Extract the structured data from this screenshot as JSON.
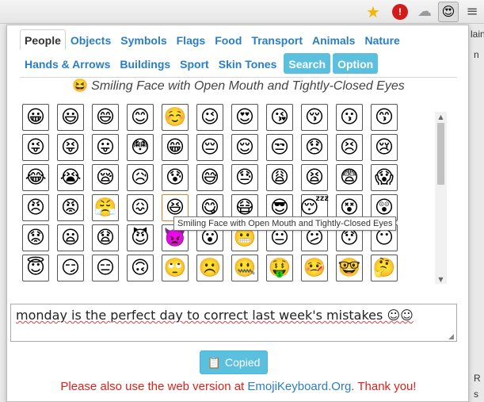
{
  "toolbar": {
    "icons": [
      "star-icon",
      "adblock-shield-icon",
      "cloud-icon",
      "emoji-keyboard-icon",
      "menu-icon"
    ],
    "star": "★",
    "shield": "!",
    "cloud": "☁",
    "emoji": "😍",
    "menu": "≡"
  },
  "background": {
    "side_text_1": "lain",
    "side_text_2": "n",
    "side_text_3": "R",
    "side_text_4": "s"
  },
  "tabs": [
    {
      "label": "People",
      "state": "active"
    },
    {
      "label": "Objects",
      "state": "normal"
    },
    {
      "label": "Symbols",
      "state": "normal"
    },
    {
      "label": "Flags",
      "state": "normal"
    },
    {
      "label": "Food",
      "state": "normal"
    },
    {
      "label": "Transport",
      "state": "normal"
    },
    {
      "label": "Animals",
      "state": "normal"
    },
    {
      "label": "Nature",
      "state": "normal"
    },
    {
      "label": "Hands & Arrows",
      "state": "normal"
    },
    {
      "label": "Buildings",
      "state": "normal"
    },
    {
      "label": "Sport",
      "state": "normal"
    },
    {
      "label": "Skin Tones",
      "state": "normal"
    },
    {
      "label": "Search",
      "state": "button"
    },
    {
      "label": "Option",
      "state": "button"
    }
  ],
  "selected": {
    "icon": "😆",
    "title": "Smiling Face with Open Mouth and Tightly-Closed Eyes"
  },
  "emoji_grid": [
    [
      "😀",
      "😃",
      "😄",
      "😊",
      "☺️",
      "😉",
      "😍",
      "😘",
      "😚",
      "😗",
      "😙"
    ],
    [
      "😜",
      "😝",
      "😛",
      "😳",
      "😁",
      "😔",
      "😌",
      "😒",
      "😞",
      "😣",
      "😢"
    ],
    [
      "😂",
      "😭",
      "😪",
      "😥",
      "😰",
      "😅",
      "😓",
      "😩",
      "😫",
      "😨",
      "😱"
    ],
    [
      "😠",
      "😡",
      "😤",
      "😖",
      "😆",
      "😋",
      "😷",
      "😎",
      "😴",
      "😵",
      "😲"
    ],
    [
      "😟",
      "😦",
      "😧",
      "😈",
      "👿",
      "😮",
      "😬",
      "😐",
      "😕",
      "😯",
      "😶"
    ],
    [
      "😇",
      "😏",
      "😑",
      "🙃",
      "🙄",
      "☹️",
      "🤐",
      "🤑",
      "🤒",
      "🤓",
      "🤔"
    ],
    [
      "🤕",
      "🙁",
      "🙂",
      "🤗",
      "👶",
      "🎅",
      "👮",
      "💂",
      "🕵",
      "👱",
      "👲"
    ]
  ],
  "hover_index": {
    "row": 3,
    "col": 4
  },
  "tooltip": "Smiling Face with Open Mouth and Tightly-Closed Eyes",
  "scroll": {
    "up": "▲",
    "down": "▼"
  },
  "textarea": {
    "value": "monday is the perfect day to correct last week's mistakes ☺☺"
  },
  "copy_button": {
    "icon": "📋",
    "label": "Copied"
  },
  "footer": {
    "prefix": "Please also use the web version at ",
    "link": "EmojiKeyboard.Org",
    "suffix": ". Thank you!"
  },
  "colors": {
    "tab_blue": "#2a7ec2",
    "button_blue": "#5bc0de",
    "footer_red": "#e0201b"
  }
}
